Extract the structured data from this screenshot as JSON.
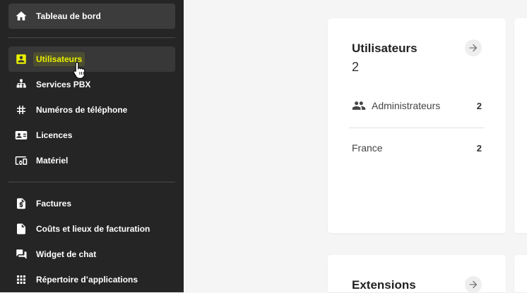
{
  "sidebar": {
    "items": [
      {
        "label": "Tableau de bord",
        "icon": "home-icon"
      },
      {
        "label": "Utilisateurs",
        "icon": "user-badge-icon"
      },
      {
        "label": "Services PBX",
        "icon": "sitemap-icon"
      },
      {
        "label": "Numéros de téléphone",
        "icon": "hash-icon"
      },
      {
        "label": "Licences",
        "icon": "license-card-icon"
      },
      {
        "label": "Matériel",
        "icon": "devices-icon"
      },
      {
        "label": "Factures",
        "icon": "invoice-icon"
      },
      {
        "label": "Coûts et lieux de facturation",
        "icon": "document-icon"
      },
      {
        "label": "Widget de chat",
        "icon": "chat-widget-icon"
      },
      {
        "label": "Répertoire d’applications",
        "icon": "apps-grid-icon"
      }
    ],
    "accent_color": "#e8f000"
  },
  "cards": {
    "users": {
      "title": "Utilisateurs",
      "count": "2",
      "rows": [
        {
          "label": "Administrateurs",
          "value": "2"
        },
        {
          "label": "France",
          "value": "2"
        }
      ]
    },
    "extensions": {
      "title": "Extensions"
    }
  }
}
